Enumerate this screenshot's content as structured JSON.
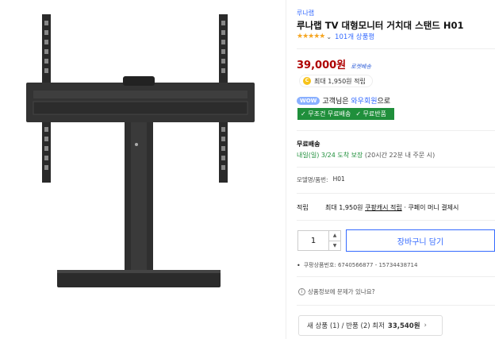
{
  "product": {
    "brand": "루나랩",
    "title": "루나랩 TV 대형모니터 거치대 스탠드 H01",
    "stars": "★★★★★",
    "rating_value": 4.5,
    "review_count": "101개 상품평",
    "price": "39,000원",
    "delivery_badge": "로켓배송",
    "cash_coin": "C",
    "cash_text": "최대 1,950원 적립",
    "wow_badge": "WOW",
    "wow_text_prefix": "고객님은",
    "wow_link": "와우회원",
    "wow_text_suffix": "으로",
    "free_shipping": "✓ 무조건 무료배송",
    "free_return": "✓ 무료반품",
    "shipping_label": "무료배송",
    "shipping_date": "내일(일) 3/24",
    "shipping_detail": "도착 보장",
    "shipping_note": "(20시간 22분 내 주문 시)",
    "model_label": "모델명/품번:",
    "model_value": "H01",
    "benefit_label": "적립",
    "benefit_prefix": "최대 1,950원",
    "benefit_link": "쿠팡캐시 적립",
    "benefit_suffix": "· 쿠페이 머니 결제시",
    "quantity": "1",
    "qty_up": "▲",
    "qty_down": "▼",
    "cart_button": "장바구니 담기",
    "product_id_label": "쿠팡상품번호:",
    "product_id_value": "6740566877 - 15734438714",
    "report_icon": "i",
    "report_text": "상품정보에 문제가 있나요?",
    "offers_prefix": "새 상품 (1) / 반품 (2) 최저",
    "offers_price": "33,540원",
    "offers_arrow": "›"
  },
  "colors": {
    "accent": "#346aff",
    "price": "#ae0000",
    "green": "#1f8f3b",
    "star": "#f5a623"
  }
}
